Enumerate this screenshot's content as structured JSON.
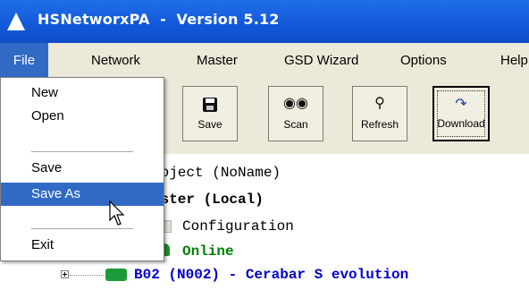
{
  "window": {
    "title": "HSNetworxPA  -  Version 5.12"
  },
  "menubar": {
    "items": [
      {
        "label": "File",
        "active": true
      },
      {
        "label": "Network"
      },
      {
        "label": "Master"
      },
      {
        "label": "GSD Wizard"
      },
      {
        "label": "Options"
      },
      {
        "label": "Help"
      }
    ]
  },
  "file_menu": {
    "items": [
      {
        "label": "New"
      },
      {
        "label": "Open"
      },
      {
        "label": "Save"
      },
      {
        "label": "Save As",
        "highlighted": true
      },
      {
        "label": "Exit"
      }
    ]
  },
  "toolbar": {
    "buttons": [
      {
        "label": "Save",
        "icon": "save-icon"
      },
      {
        "label": "Scan",
        "icon": "binoculars-icon"
      },
      {
        "label": "Refresh",
        "icon": "magnifier-icon"
      },
      {
        "label": "Download",
        "icon": "download-arrow-icon",
        "pressed": true
      }
    ]
  },
  "tree": {
    "project": "roject (NoName)",
    "master": "aster (Local)",
    "configuration": "Configuration",
    "online": "Online",
    "device": "B02 (N002) - Cerabar S evolution"
  },
  "colors": {
    "titlebar": "#1257d9",
    "highlight": "#316ac5",
    "online": "#008000",
    "device": "#0000cc"
  }
}
